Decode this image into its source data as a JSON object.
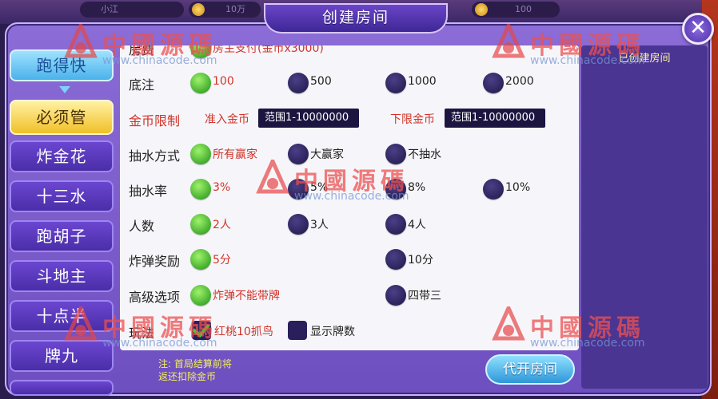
{
  "top_bar": {
    "player_name": "小江",
    "balance": "10万",
    "coin_value": "100"
  },
  "dialog": {
    "title": "创建房间",
    "close_symbol": "✕"
  },
  "game_list": [
    {
      "label": "跑得快",
      "state": "top"
    },
    {
      "label": "必须管",
      "state": "active"
    },
    {
      "label": "炸金花",
      "state": ""
    },
    {
      "label": "十三水",
      "state": ""
    },
    {
      "label": "跑胡子",
      "state": ""
    },
    {
      "label": "斗地主",
      "state": ""
    },
    {
      "label": "十点半",
      "state": ""
    },
    {
      "label": "牌九",
      "state": ""
    }
  ],
  "room_fee": {
    "label": "房费",
    "value": "房主支付(金币x3000)"
  },
  "base_bet": {
    "label": "底注",
    "options": [
      "100",
      "500",
      "1000",
      "2000"
    ],
    "selected": 0
  },
  "coin_limit": {
    "label": "金币限制",
    "entry_label": "准入金币",
    "entry_value": "范围1-10000000",
    "lower_label": "下限金币",
    "lower_value": "范围1-10000000"
  },
  "rake_method": {
    "label": "抽水方式",
    "options": [
      "所有赢家",
      "大赢家",
      "不抽水"
    ],
    "selected": 0
  },
  "rake_rate": {
    "label": "抽水率",
    "options": [
      "3%",
      "5%",
      "8%",
      "10%"
    ],
    "selected": 0
  },
  "players": {
    "label": "人数",
    "options": [
      "2人",
      "3人",
      "4人"
    ],
    "selected": 0
  },
  "bomb_reward": {
    "label": "炸弹奖励",
    "options": [
      "5分",
      "10分"
    ],
    "selected": 0
  },
  "advanced": {
    "label": "高级选项",
    "options": [
      "炸弹不能带牌",
      "四带三"
    ],
    "selected": 0
  },
  "play_style": {
    "label": "玩法",
    "options": [
      "红桃10抓鸟",
      "显示牌数"
    ],
    "checked": [
      true,
      false
    ]
  },
  "footer": {
    "note_line1": "注: 首局结算前将",
    "note_line2": "返还扣除金币",
    "proxy_button": "代开房间"
  },
  "rooms_panel": {
    "tab_label": "已创建房间"
  },
  "watermark": {
    "text": "中國源碼",
    "url": "www.chinacode.com"
  },
  "colors": {
    "accent_red": "#d0342a",
    "radio_on": "#3fbf25",
    "panel_bg": "#f6f6fa",
    "dialog_purple": "#7a5bcc"
  }
}
